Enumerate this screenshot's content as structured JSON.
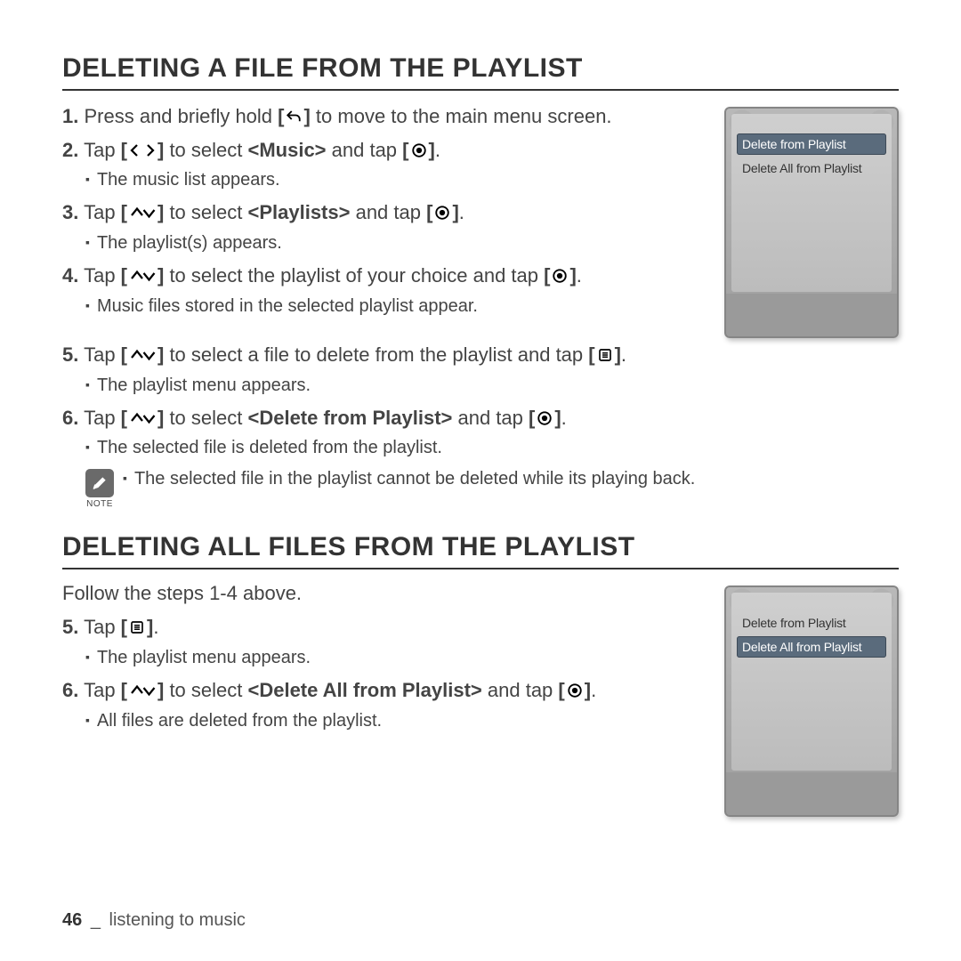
{
  "section1": {
    "title": "DELETING A FILE FROM THE PLAYLIST",
    "steps": {
      "s1_num": "1.",
      "s1_a": "Press and briefly hold ",
      "s1_b": " to move to the main menu screen.",
      "s2_num": "2.",
      "s2_a": "Tap ",
      "s2_b": " to select ",
      "s2_bold": "<Music>",
      "s2_c": " and tap ",
      "s2_sub": "The music list appears.",
      "s3_num": "3.",
      "s3_a": "Tap ",
      "s3_b": " to select ",
      "s3_bold": "<Playlists>",
      "s3_c": " and tap ",
      "s3_sub": "The playlist(s) appears.",
      "s4_num": "4.",
      "s4_a": "Tap ",
      "s4_b": " to select the playlist of your choice and tap ",
      "s4_sub": "Music files stored in the selected playlist appear.",
      "s5_num": "5.",
      "s5_a": "Tap ",
      "s5_b": " to select a file to delete from the playlist and tap ",
      "s5_sub": "The playlist menu appears.",
      "s6_num": "6.",
      "s6_a": "Tap ",
      "s6_b": " to select ",
      "s6_bold": "<Delete from Playlist>",
      "s6_c": " and tap ",
      "s6_sub": "The selected file is deleted from the playlist."
    },
    "note": {
      "label": "NOTE",
      "text": "The selected file in the playlist cannot be deleted while its playing back."
    },
    "device_menu": {
      "item1": "Delete from Playlist",
      "item2": "Delete All from Playlist"
    }
  },
  "section2": {
    "title": "DELETING ALL FILES FROM THE PLAYLIST",
    "intro": "Follow the steps 1-4 above.",
    "steps": {
      "s5_num": "5.",
      "s5_a": "Tap ",
      "s5_sub": "The playlist menu appears.",
      "s6_num": "6.",
      "s6_a": "Tap ",
      "s6_b": " to select ",
      "s6_bold": "<Delete All from Playlist>",
      "s6_c": " and tap ",
      "s6_sub": "All files are deleted from the playlist."
    },
    "device_menu": {
      "item1": "Delete from Playlist",
      "item2": "Delete All from Playlist"
    }
  },
  "footer": {
    "page": "46",
    "sep": "_",
    "chapter": "listening to music"
  }
}
